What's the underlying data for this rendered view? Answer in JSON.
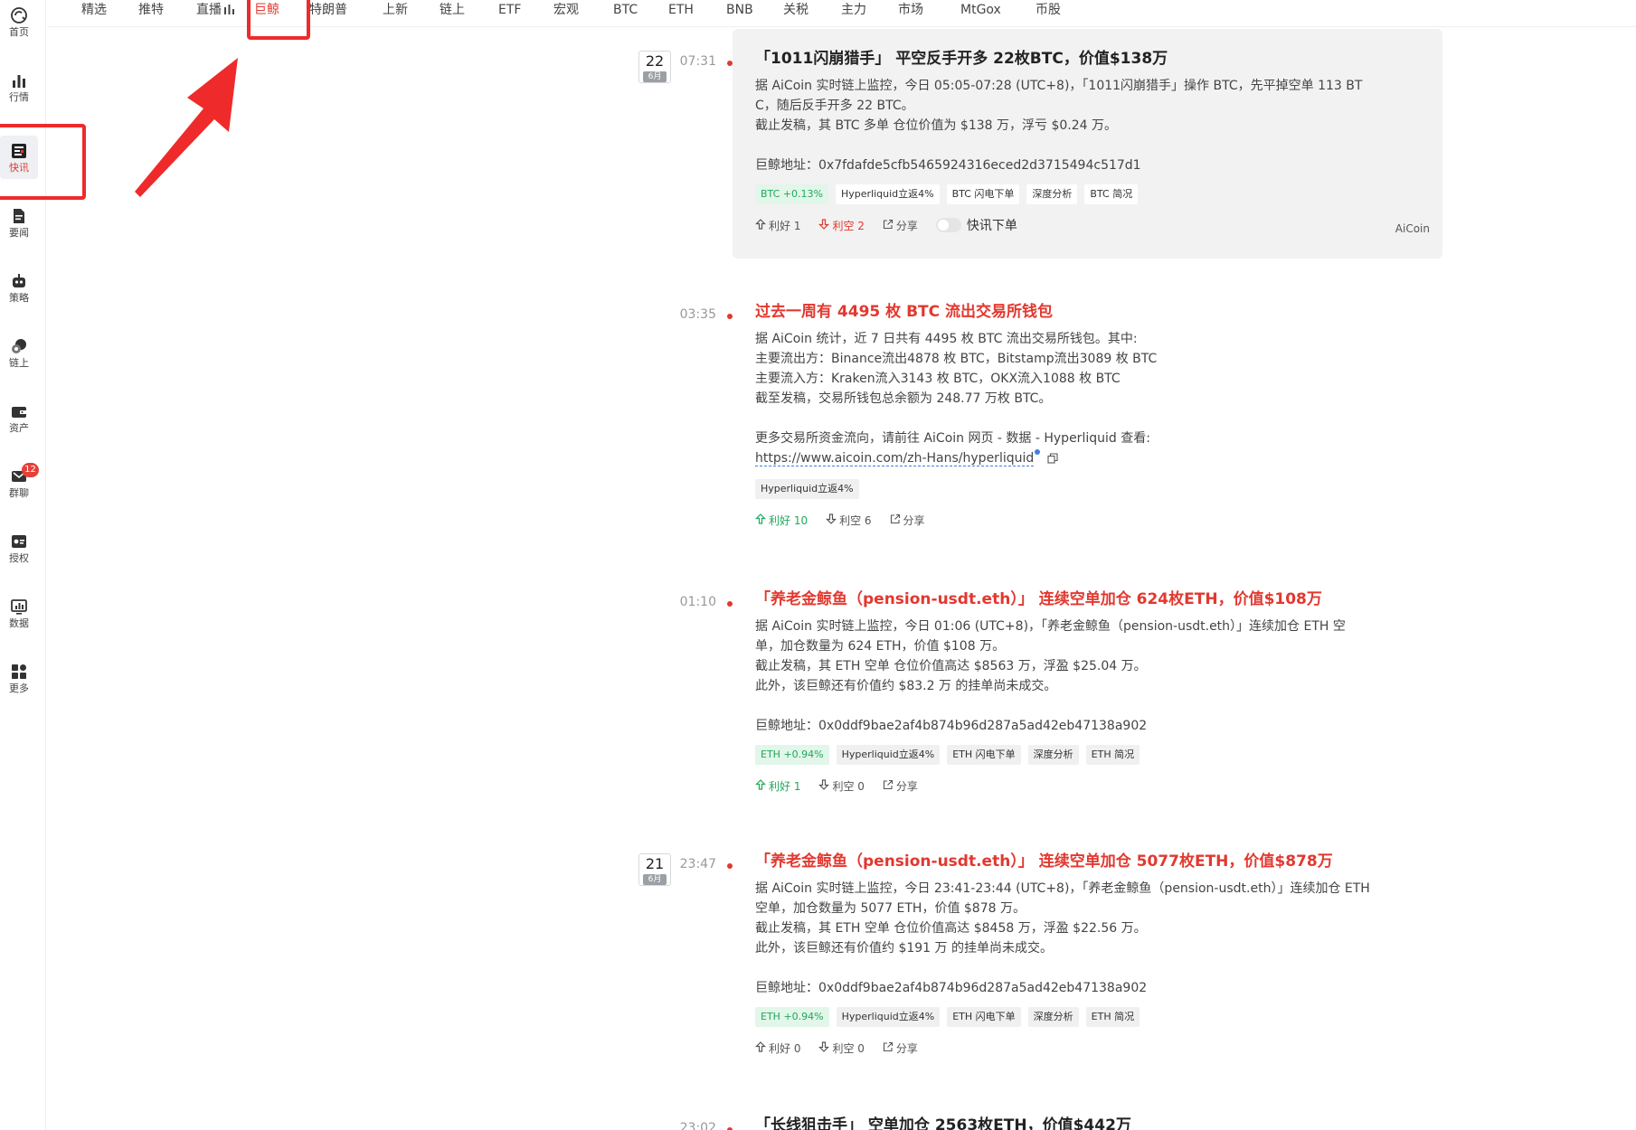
{
  "sidebar": {
    "items": [
      {
        "label": "首页",
        "icon": "home-logo-icon"
      },
      {
        "label": "行情",
        "icon": "market-bars-icon"
      },
      {
        "label": "快讯",
        "icon": "news-flash-icon",
        "active": true
      },
      {
        "label": "要闻",
        "icon": "document-icon"
      },
      {
        "label": "策略",
        "icon": "robot-icon"
      },
      {
        "label": "链上",
        "icon": "chain-icon"
      },
      {
        "label": "资产",
        "icon": "wallet-icon"
      },
      {
        "label": "群聊",
        "icon": "chat-icon",
        "badge": "12"
      },
      {
        "label": "授权",
        "icon": "auth-icon"
      },
      {
        "label": "数据",
        "icon": "monitor-chart-icon"
      },
      {
        "label": "更多",
        "icon": "grid-more-icon"
      }
    ]
  },
  "tabs": [
    "精选",
    "推特",
    "直播",
    "巨鲸",
    "特朗普",
    "上新",
    "链上",
    "ETF",
    "宏观",
    "BTC",
    "ETH",
    "BNB",
    "关税",
    "主力",
    "市场",
    "MtGox",
    "币股"
  ],
  "active_tab": "巨鲸",
  "colors": {
    "accent_red": "#e2382f",
    "green": "#1fa85a",
    "annotation_red": "#ef2a2a"
  },
  "feed": {
    "items": [
      {
        "date": {
          "day": "22",
          "month": "6月"
        },
        "time": "07:31",
        "title": "「1011闪崩猎手」 平空反手开多 22枚BTC，价值$138万",
        "title_red": false,
        "highlighted": true,
        "lines": [
          "据 AiCoin 实时链上监控，今日 05:05-07:28 (UTC+8)，「1011闪崩猎手」操作 BTC，先平掉空单 113 BT",
          "C，随后反手开多 22 BTC。",
          "截止发稿，其 BTC 多单 仓位价值为 $138 万，浮亏 $0.24 万。",
          "",
          "巨鲸地址：0x7fdafde5cfb5465924316eced2d3715494c517d1"
        ],
        "tags": [
          {
            "text": "BTC +0.13%",
            "green": true
          },
          {
            "text": "Hyperliquid立返4%"
          },
          {
            "text": "BTC 闪电下单"
          },
          {
            "text": "深度分析"
          },
          {
            "text": "BTC 简况"
          }
        ],
        "bull": "利好 1",
        "bear": "利空 2",
        "share": "分享",
        "toggle_label": "快讯下单",
        "source": "AiCoin"
      },
      {
        "time": "03:35",
        "title": "过去一周有 4495 枚 BTC 流出交易所钱包",
        "title_red": true,
        "lines": [
          "据 AiCoin 统计，近 7 日共有 4495 枚 BTC 流出交易所钱包。其中:",
          "主要流出方：Binance流出4878 枚 BTC，Bitstamp流出3089 枚 BTC",
          "主要流入方：Kraken流入3143 枚 BTC，OKX流入1088 枚 BTC",
          "截至发稿，交易所钱包总余额为 248.77 万枚 BTC。",
          "",
          "更多交易所资金流向，请前往 AiCoin 网页 - 数据 - Hyperliquid 查看:"
        ],
        "link": "https://www.aicoin.com/zh-Hans/hyperliquid",
        "tags": [
          {
            "text": "Hyperliquid立返4%"
          }
        ],
        "bull": "利好 10",
        "bull_green": true,
        "bear": "利空 6",
        "share": "分享"
      },
      {
        "time": "01:10",
        "title": "「养老金鲸鱼（pension-usdt.eth）」 连续空单加仓 624枚ETH，价值$108万",
        "title_red": true,
        "lines": [
          "据 AiCoin 实时链上监控，今日 01:06 (UTC+8)，「养老金鲸鱼（pension-usdt.eth）」连续加仓 ETH 空",
          "单，加仓数量为 624 ETH，价值 $108 万。",
          "截止发稿，其 ETH 空单 仓位价值高达 $8563 万，浮盈 $25.04 万。",
          "此外，该巨鲸还有价值约 $83.2 万 的挂单尚未成交。",
          "",
          "巨鲸地址：0x0ddf9bae2af4b874b96d287a5ad42eb47138a902"
        ],
        "tags": [
          {
            "text": "ETH +0.94%",
            "green": true
          },
          {
            "text": "Hyperliquid立返4%"
          },
          {
            "text": "ETH 闪电下单"
          },
          {
            "text": "深度分析"
          },
          {
            "text": "ETH 简况"
          }
        ],
        "bull": "利好 1",
        "bull_green": true,
        "bear": "利空 0",
        "share": "分享"
      },
      {
        "date": {
          "day": "21",
          "month": "6月"
        },
        "time": "23:47",
        "title": "「养老金鲸鱼（pension-usdt.eth）」 连续空单加仓 5077枚ETH，价值$878万",
        "title_red": true,
        "lines": [
          "据 AiCoin 实时链上监控，今日 23:41-23:44 (UTC+8)，「养老金鲸鱼（pension-usdt.eth）」连续加仓 ETH",
          "空单，加仓数量为 5077 ETH，价值 $878 万。",
          "截止发稿，其 ETH 空单 仓位价值高达 $8458 万，浮盈 $22.56 万。",
          "此外，该巨鲸还有价值约 $191 万 的挂单尚未成交。",
          "",
          "巨鲸地址：0x0ddf9bae2af4b874b96d287a5ad42eb47138a902"
        ],
        "tags": [
          {
            "text": "ETH +0.94%",
            "green": true
          },
          {
            "text": "Hyperliquid立返4%"
          },
          {
            "text": "ETH 闪电下单"
          },
          {
            "text": "深度分析"
          },
          {
            "text": "ETH 简况"
          }
        ],
        "bull": "利好 0",
        "bear": "利空 0",
        "share": "分享"
      },
      {
        "time": "23:02",
        "title": "「长线狙击手」 空单加仓 2563枚ETH，价值$442万",
        "title_red": false
      }
    ]
  }
}
